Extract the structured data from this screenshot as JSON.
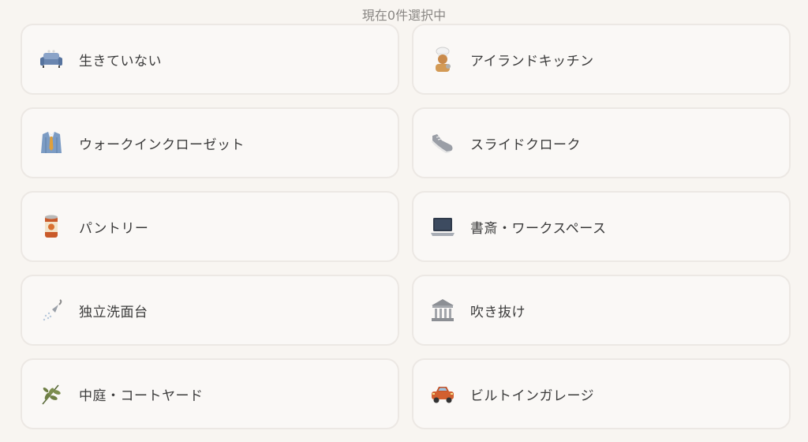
{
  "status_text": "現在0件選択中",
  "options": [
    {
      "label": "生きていない",
      "icon": "sofa-icon"
    },
    {
      "label": "アイランドキッチン",
      "icon": "chef-icon"
    },
    {
      "label": "ウォークインクローゼット",
      "icon": "shirt-tie-icon"
    },
    {
      "label": "スライドクローク",
      "icon": "sneaker-icon"
    },
    {
      "label": "パントリー",
      "icon": "canned-food-icon"
    },
    {
      "label": "書斎・ワークスペース",
      "icon": "laptop-icon"
    },
    {
      "label": "独立洗面台",
      "icon": "shower-icon"
    },
    {
      "label": "吹き抜け",
      "icon": "classical-building-icon"
    },
    {
      "label": "中庭・コートヤード",
      "icon": "herb-icon"
    },
    {
      "label": "ビルトインガレージ",
      "icon": "car-icon"
    }
  ]
}
